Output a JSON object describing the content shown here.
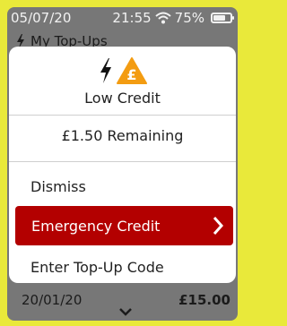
{
  "status": {
    "date": "05/07/20",
    "time": "21:55",
    "battery": "75%"
  },
  "background": {
    "header": "My Top-Ups",
    "row": {
      "date": "20/01/20",
      "amount": "£15.00"
    }
  },
  "modal": {
    "title": "Low Credit",
    "remaining": "£1.50 Remaining",
    "options": [
      {
        "label": "Dismiss"
      },
      {
        "label": "Emergency Credit"
      },
      {
        "label": "Enter Top-Up Code"
      }
    ],
    "pound_symbol": "£"
  },
  "colors": {
    "accent": "#b30000",
    "warning": "#f39c12",
    "frame": "#e9e93a"
  }
}
